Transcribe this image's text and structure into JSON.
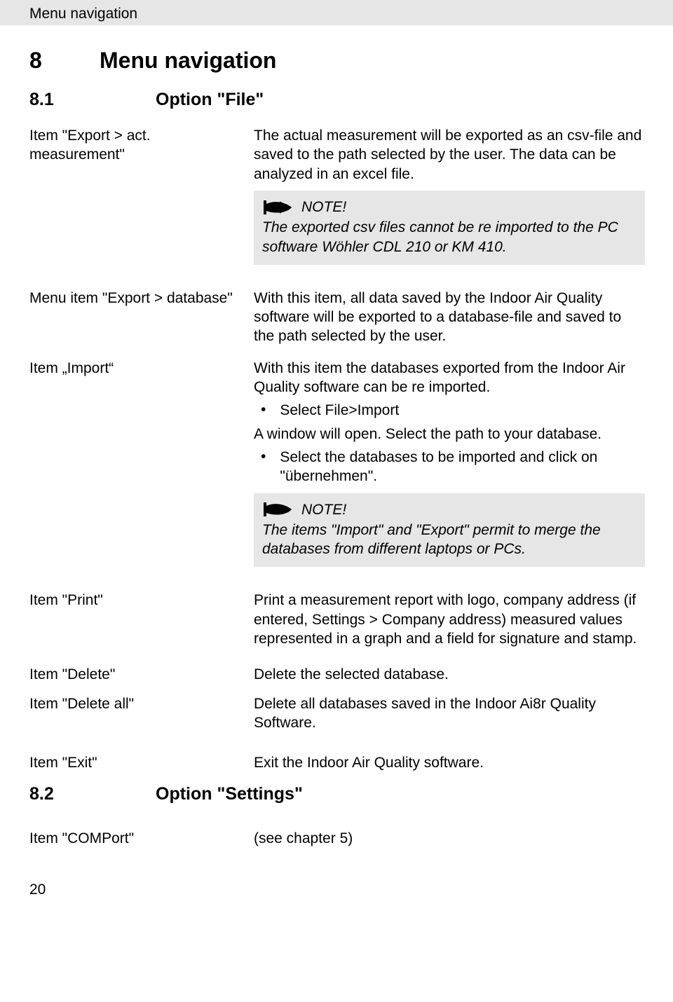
{
  "tab_title": "Menu navigation",
  "section8": {
    "num": "8",
    "title": "Menu navigation"
  },
  "section81": {
    "num": "8.1",
    "title": "Option \"File\""
  },
  "export_act": {
    "label": "Item \"Export > act. measurement\"",
    "desc1": "The actual measurement will be exported as an csv-file and saved to the path selected by the user. The data can be analyzed in an excel file.",
    "note_label": "NOTE!",
    "note_body": "The exported csv files cannot be re imported to the PC software Wöhler CDL 210 or KM 410."
  },
  "export_db": {
    "label": "Menu item \"Export > database\"",
    "desc": "With this item, all data saved by the Indoor Air Quality software will be exported to a database-file and saved to the path selected by the user."
  },
  "import": {
    "label": "Item „Import“",
    "desc1": "With this item the databases exported from the Indoor Air Quality software can be re imported.",
    "bullet1": "Select File>Import",
    "desc2": "A window will open. Select the path to your database.",
    "bullet2": "Select the databases to be imported and click on \"übernehmen\".",
    "note_label": "NOTE!",
    "note_body": "The items \"Import\" and \"Export\" permit to merge the databases from different laptops or PCs."
  },
  "print": {
    "label": "Item \"Print\"",
    "desc": "Print a measurement report with logo, company address (if entered, Settings > Company address) measured values represented in a graph and a field for signature and stamp."
  },
  "delete": {
    "label": "Item \"Delete\"",
    "desc": "Delete the selected database."
  },
  "delete_all": {
    "label": "Item \"Delete all\"",
    "desc": "Delete all databases saved in the Indoor Ai8r Quality Software."
  },
  "exit": {
    "label": "Item \"Exit\"",
    "desc": "Exit the Indoor Air Quality software."
  },
  "section82": {
    "num": "8.2",
    "title": "Option \"Settings\""
  },
  "comport": {
    "label": "Item \"COMPort\"",
    "desc": "(see chapter 5)"
  },
  "page_number": "20"
}
